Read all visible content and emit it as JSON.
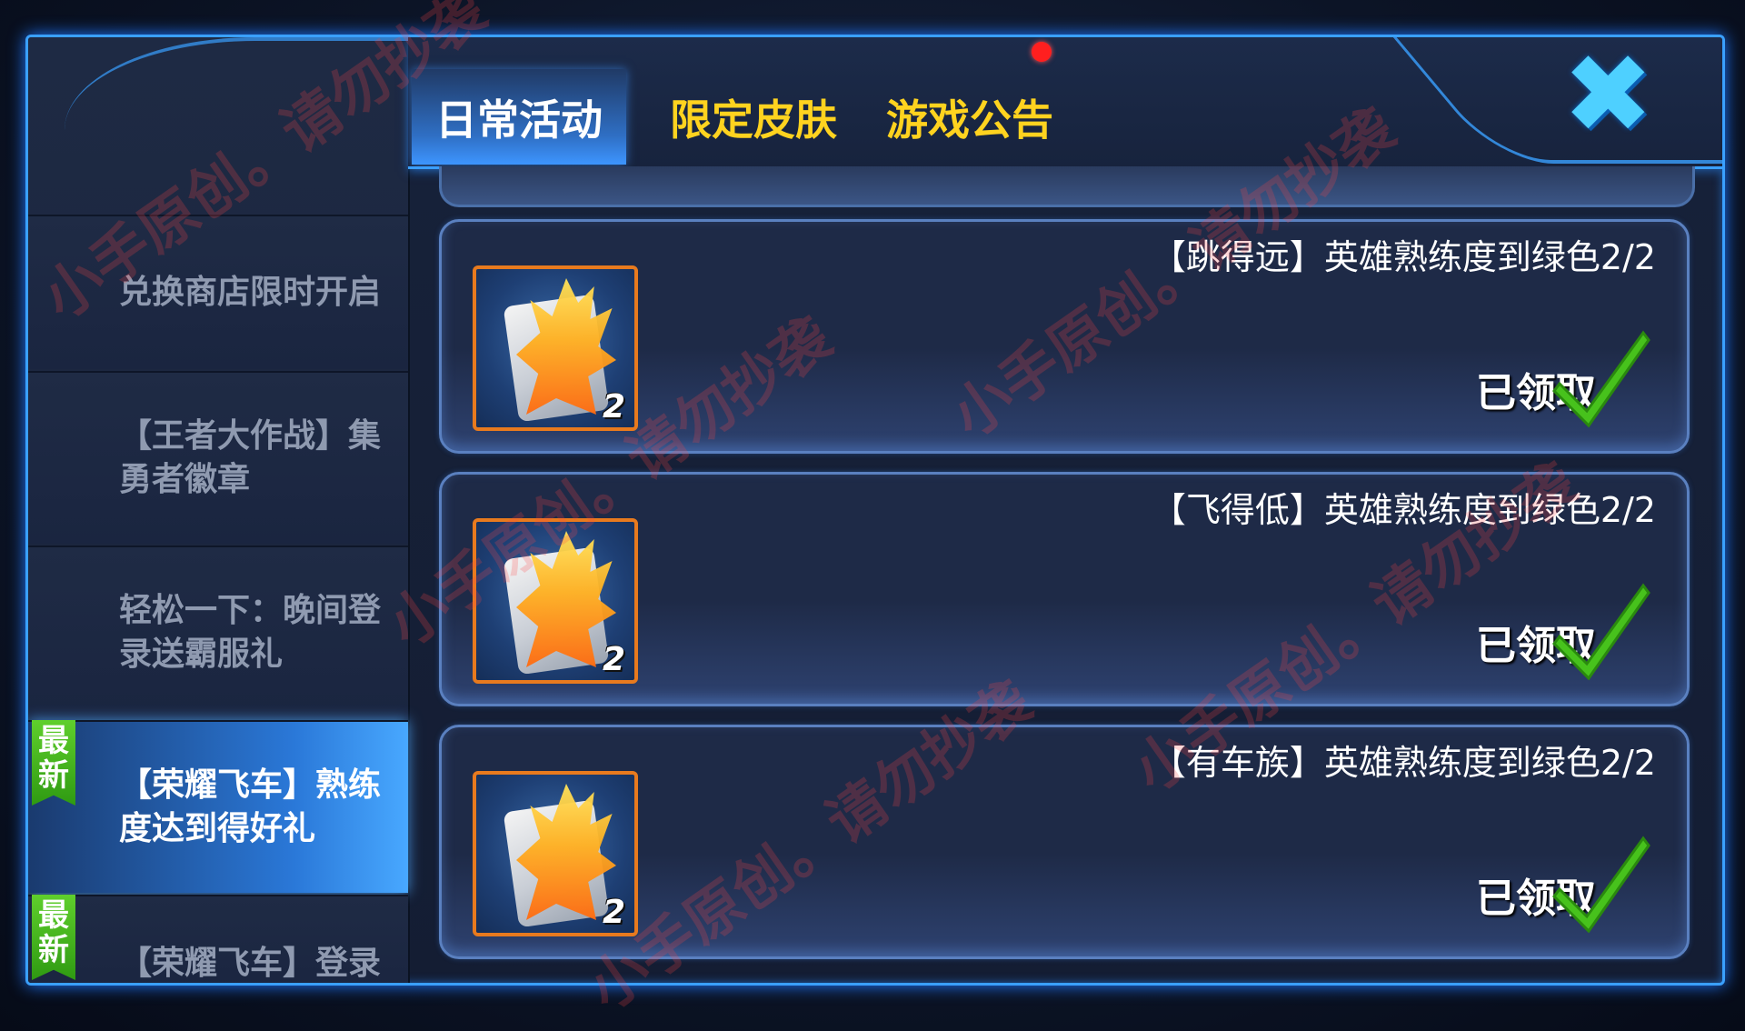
{
  "tabs": [
    {
      "label": "日常活动",
      "active": true
    },
    {
      "label": "限定皮肤",
      "active": false
    },
    {
      "label": "游戏公告",
      "active": false
    }
  ],
  "sidebar": {
    "items": [
      {
        "line1": "兑换商店限时开启",
        "line2": "",
        "active": false,
        "badge": ""
      },
      {
        "line1": "【王者大作战】集",
        "line2": "勇者徽章",
        "active": false,
        "badge": ""
      },
      {
        "line1": "轻松一下：晚间登",
        "line2": "录送霸服礼",
        "active": false,
        "badge": ""
      },
      {
        "line1": "【荣耀飞车】熟练",
        "line2": "度达到得好礼",
        "active": true,
        "badge": "最新"
      },
      {
        "line1": "【荣耀飞车】登录",
        "line2": "",
        "active": false,
        "badge": "最新"
      }
    ]
  },
  "tasks": [
    {
      "title": "【跳得远】英雄熟练度到绿色2/2",
      "reward_qty": "2",
      "reward_icon": "skill-card-icon",
      "status": "已领取"
    },
    {
      "title": "【飞得低】英雄熟练度到绿色2/2",
      "reward_qty": "2",
      "reward_icon": "skill-card-icon",
      "status": "已领取"
    },
    {
      "title": "【有车族】英雄熟练度到绿色2/2",
      "reward_qty": "2",
      "reward_icon": "skill-card-icon",
      "status": "已领取"
    }
  ],
  "watermark": "小手原创。请勿抄袭",
  "colors": {
    "accent_blue": "#3aa0ff",
    "tab_inactive": "#ffd31f",
    "badge_green": "#3fb31a",
    "check_green": "#47c21c",
    "notification_red": "#ff1f1f"
  },
  "icons": {
    "close": "close-x-icon",
    "notification": "red-dot-icon",
    "claimed": "check-icon"
  }
}
